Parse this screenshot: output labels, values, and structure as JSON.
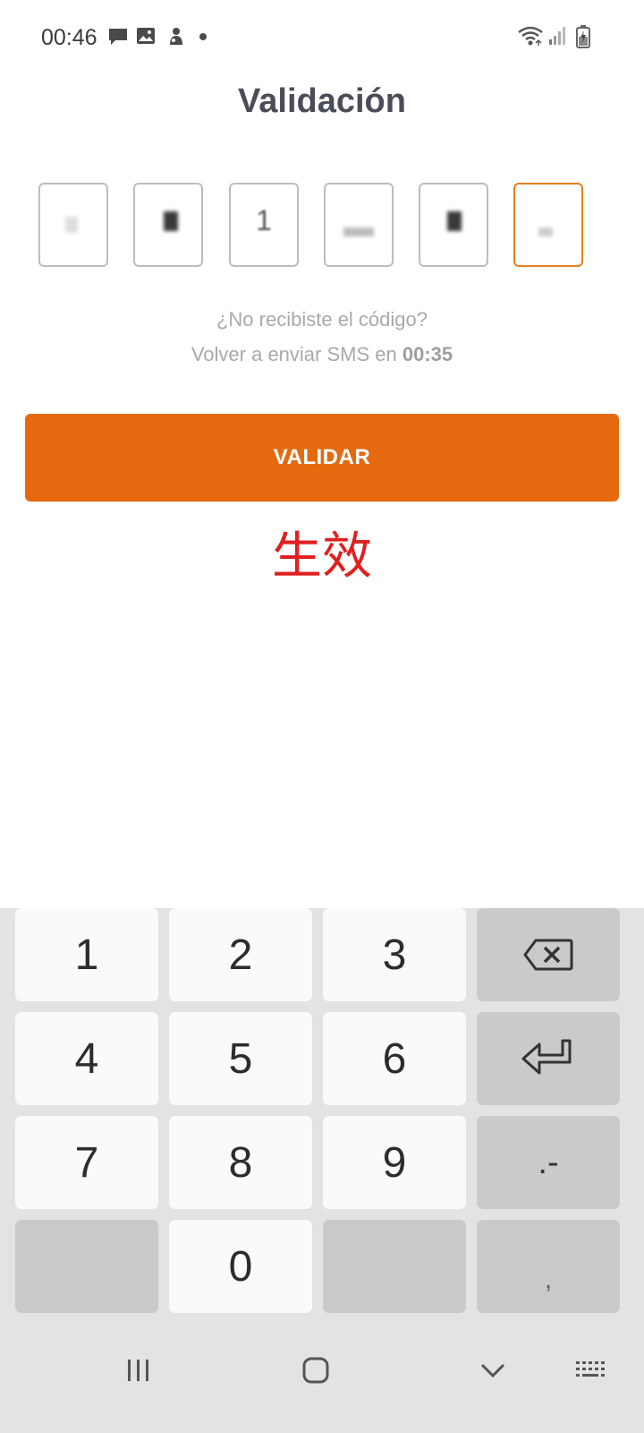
{
  "status_bar": {
    "time": "00:46",
    "left_icons": [
      "message-icon",
      "image-icon",
      "app-notification-icon",
      "dot-icon"
    ],
    "right_icons": [
      "wifi-icon",
      "signal-icon",
      "battery-charging-icon"
    ]
  },
  "page": {
    "title": "Validación"
  },
  "otp": {
    "digits": [
      "",
      "",
      "1",
      "",
      "",
      ""
    ],
    "active_index": 5
  },
  "resend": {
    "question": "¿No recibiste el código?",
    "line_prefix": "Volver a enviar SMS en ",
    "timer": "00:35"
  },
  "validate_button": {
    "label": "VALIDAR",
    "color": "#e56a0f"
  },
  "annotation": {
    "text": "生效",
    "color": "#e02020"
  },
  "keyboard": {
    "keys": {
      "k1": "1",
      "k2": "2",
      "k3": "3",
      "k4": "4",
      "k5": "5",
      "k6": "6",
      "k7": "7",
      "k8": "8",
      "k9": "9",
      "k0": "0",
      "punct_dot_dash": ".-",
      "comma": ","
    },
    "icons": [
      "backspace-icon",
      "enter-icon"
    ]
  },
  "nav_bar": {
    "icons": [
      "recent-apps-icon",
      "home-icon",
      "hide-keyboard-icon",
      "keyboard-switch-icon"
    ]
  }
}
